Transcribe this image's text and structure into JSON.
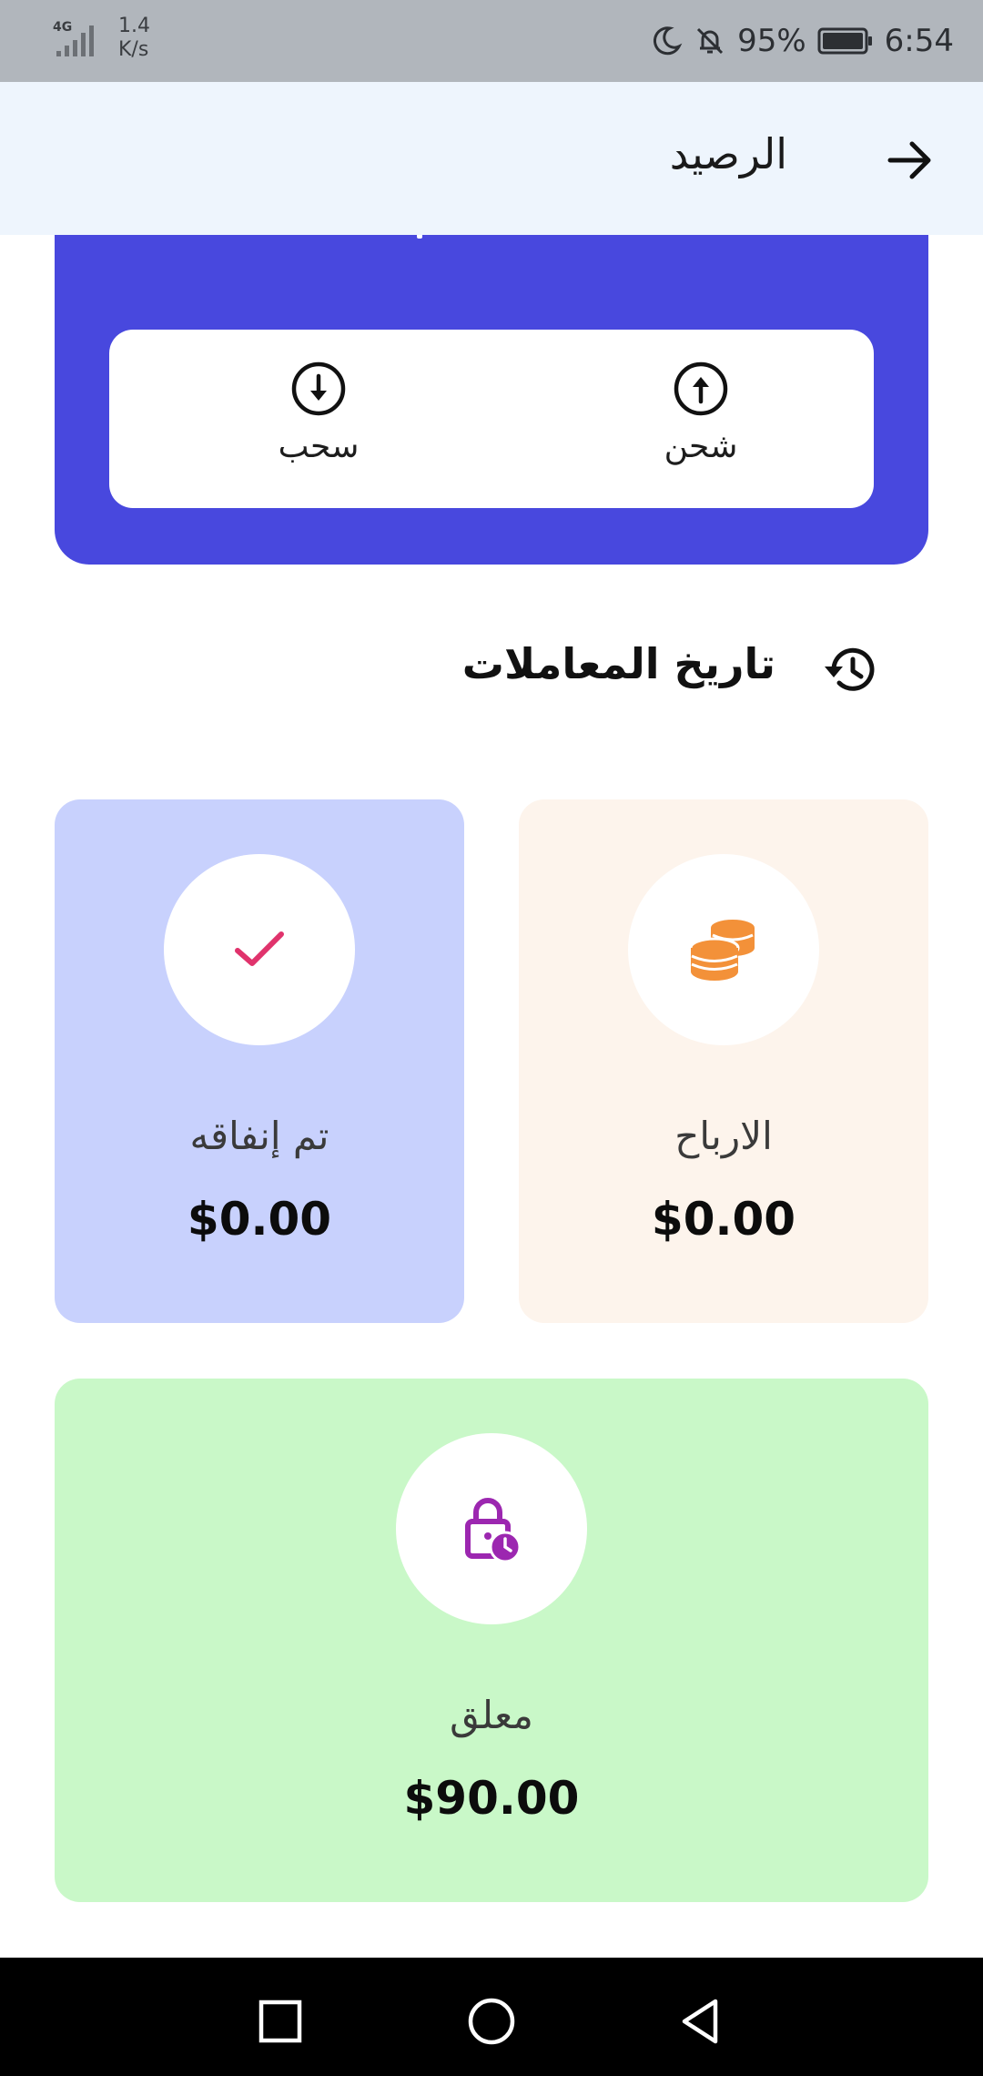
{
  "status_bar": {
    "network": "4G",
    "speed_value": "1.4",
    "speed_unit": "K/s",
    "battery": "95%",
    "time": "6:54"
  },
  "app_bar": {
    "title": "الرصيد"
  },
  "actions": {
    "withdraw_label": "سحب",
    "topup_label": "شحن"
  },
  "history": {
    "title": "تاريخ المعاملات"
  },
  "cards": {
    "spent": {
      "label": "تم إنفاقه",
      "amount": "$0.00"
    },
    "earnings": {
      "label": "الارباح",
      "amount": "$0.00"
    },
    "locked": {
      "label": "معلق",
      "amount": "$90.00"
    }
  },
  "colors": {
    "brand": "#4848de",
    "spent_bg": "#c8d1fd",
    "earnings_bg": "#fdf4ec",
    "locked_bg": "#c9f8c8",
    "check_icon": "#e0336c",
    "coins_icon": "#f39139",
    "lock_icon": "#9c27b0"
  },
  "icons": {
    "back": "arrow-right-icon",
    "withdraw": "arrow-down-circle-icon",
    "topup": "arrow-up-circle-icon",
    "history": "history-icon",
    "spent": "check-icon",
    "earnings": "coins-icon",
    "locked": "lock-clock-icon"
  }
}
